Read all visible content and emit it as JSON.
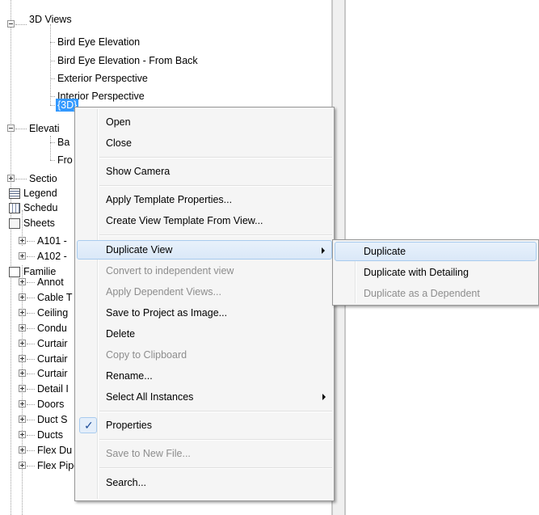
{
  "tree": {
    "views_3d": {
      "label": "3D Views"
    },
    "views_3d_children": [
      "Bird Eye Elevation",
      "Bird Eye Elevation - From Back",
      "Exterior Perspective",
      "Interior Perspective",
      "{3D}"
    ],
    "elevations": {
      "label": "Elevati",
      "children": [
        "Ba",
        "Fro"
      ]
    },
    "sections": {
      "label": "Sectio"
    },
    "legends": {
      "label": "Legend"
    },
    "schedules": {
      "label": "Schedu"
    },
    "sheets": {
      "label": "Sheets",
      "children": [
        "A101 -",
        "A102 -"
      ]
    },
    "families": {
      "label": "Familie"
    },
    "family_items": [
      "Annot",
      "Cable T",
      "Ceiling",
      "Condu",
      "Curtair",
      "Curtair",
      "Curtair",
      "Detail I",
      "Doors",
      "Duct S",
      "Ducts",
      "Flex Du",
      "Flex Pipes"
    ]
  },
  "context_menu": {
    "items": [
      {
        "label": "Open",
        "enabled": true
      },
      {
        "label": "Close",
        "enabled": true
      },
      {
        "label": "Show Camera",
        "enabled": true
      },
      {
        "label": "Apply Template Properties...",
        "enabled": true
      },
      {
        "label": "Create View Template From View...",
        "enabled": true
      },
      {
        "label": "Duplicate View",
        "enabled": true,
        "submenu": true,
        "highlighted": true
      },
      {
        "label": "Convert to independent view",
        "enabled": false
      },
      {
        "label": "Apply Dependent Views...",
        "enabled": false
      },
      {
        "label": "Save to Project as Image...",
        "enabled": true
      },
      {
        "label": "Delete",
        "enabled": true
      },
      {
        "label": "Copy to Clipboard",
        "enabled": false
      },
      {
        "label": "Rename...",
        "enabled": true
      },
      {
        "label": "Select All Instances",
        "enabled": true,
        "submenu": true
      },
      {
        "label": "Properties",
        "enabled": true,
        "checked": true
      },
      {
        "label": "Save to New File...",
        "enabled": false
      },
      {
        "label": "Search...",
        "enabled": true
      }
    ]
  },
  "submenu": {
    "items": [
      {
        "label": "Duplicate",
        "enabled": true,
        "highlighted": true
      },
      {
        "label": "Duplicate with Detailing",
        "enabled": true
      },
      {
        "label": "Duplicate as a Dependent",
        "enabled": false
      }
    ]
  },
  "colors": {
    "selection": "#3399ff",
    "menu_bg": "#f5f5f5",
    "highlight": "#dae8f8",
    "disabled_text": "#8d8d8d"
  },
  "icons": {
    "check": "✓"
  }
}
